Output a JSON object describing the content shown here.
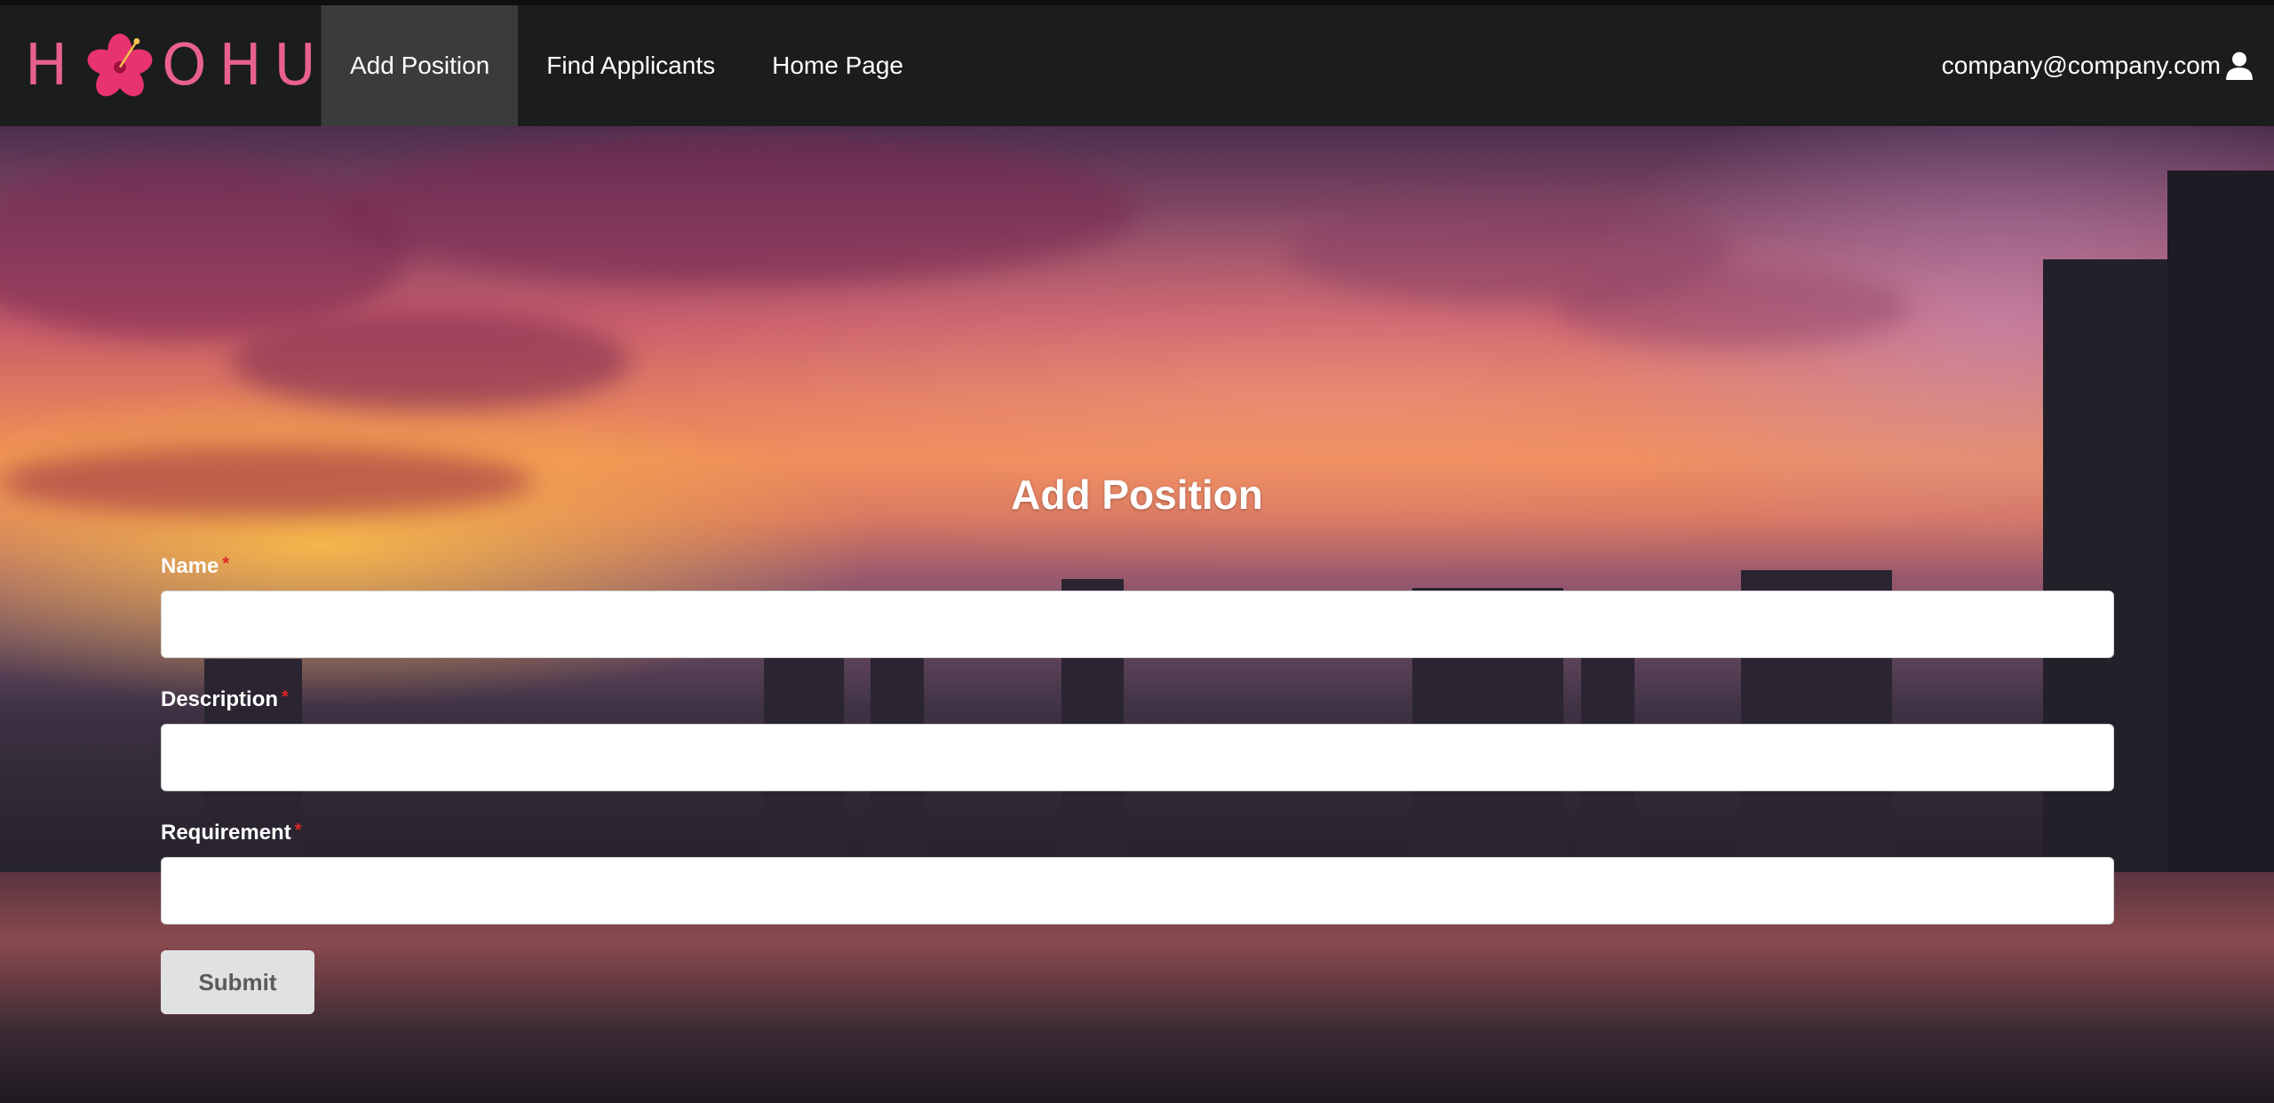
{
  "brand": {
    "logo_text_left": "H",
    "logo_text_right": "OHUI",
    "accent_color": "#e8618c"
  },
  "nav": {
    "items": [
      {
        "label": "Add Position",
        "active": true
      },
      {
        "label": "Find Applicants",
        "active": false
      },
      {
        "label": "Home Page",
        "active": false
      }
    ],
    "user_email": "company@company.com",
    "user_icon": "user-icon"
  },
  "form": {
    "title": "Add Position",
    "fields": [
      {
        "label": "Name",
        "required_mark": "*",
        "value": ""
      },
      {
        "label": "Description",
        "required_mark": "*",
        "value": ""
      },
      {
        "label": "Requirement",
        "required_mark": "*",
        "value": ""
      }
    ],
    "submit_label": "Submit"
  }
}
